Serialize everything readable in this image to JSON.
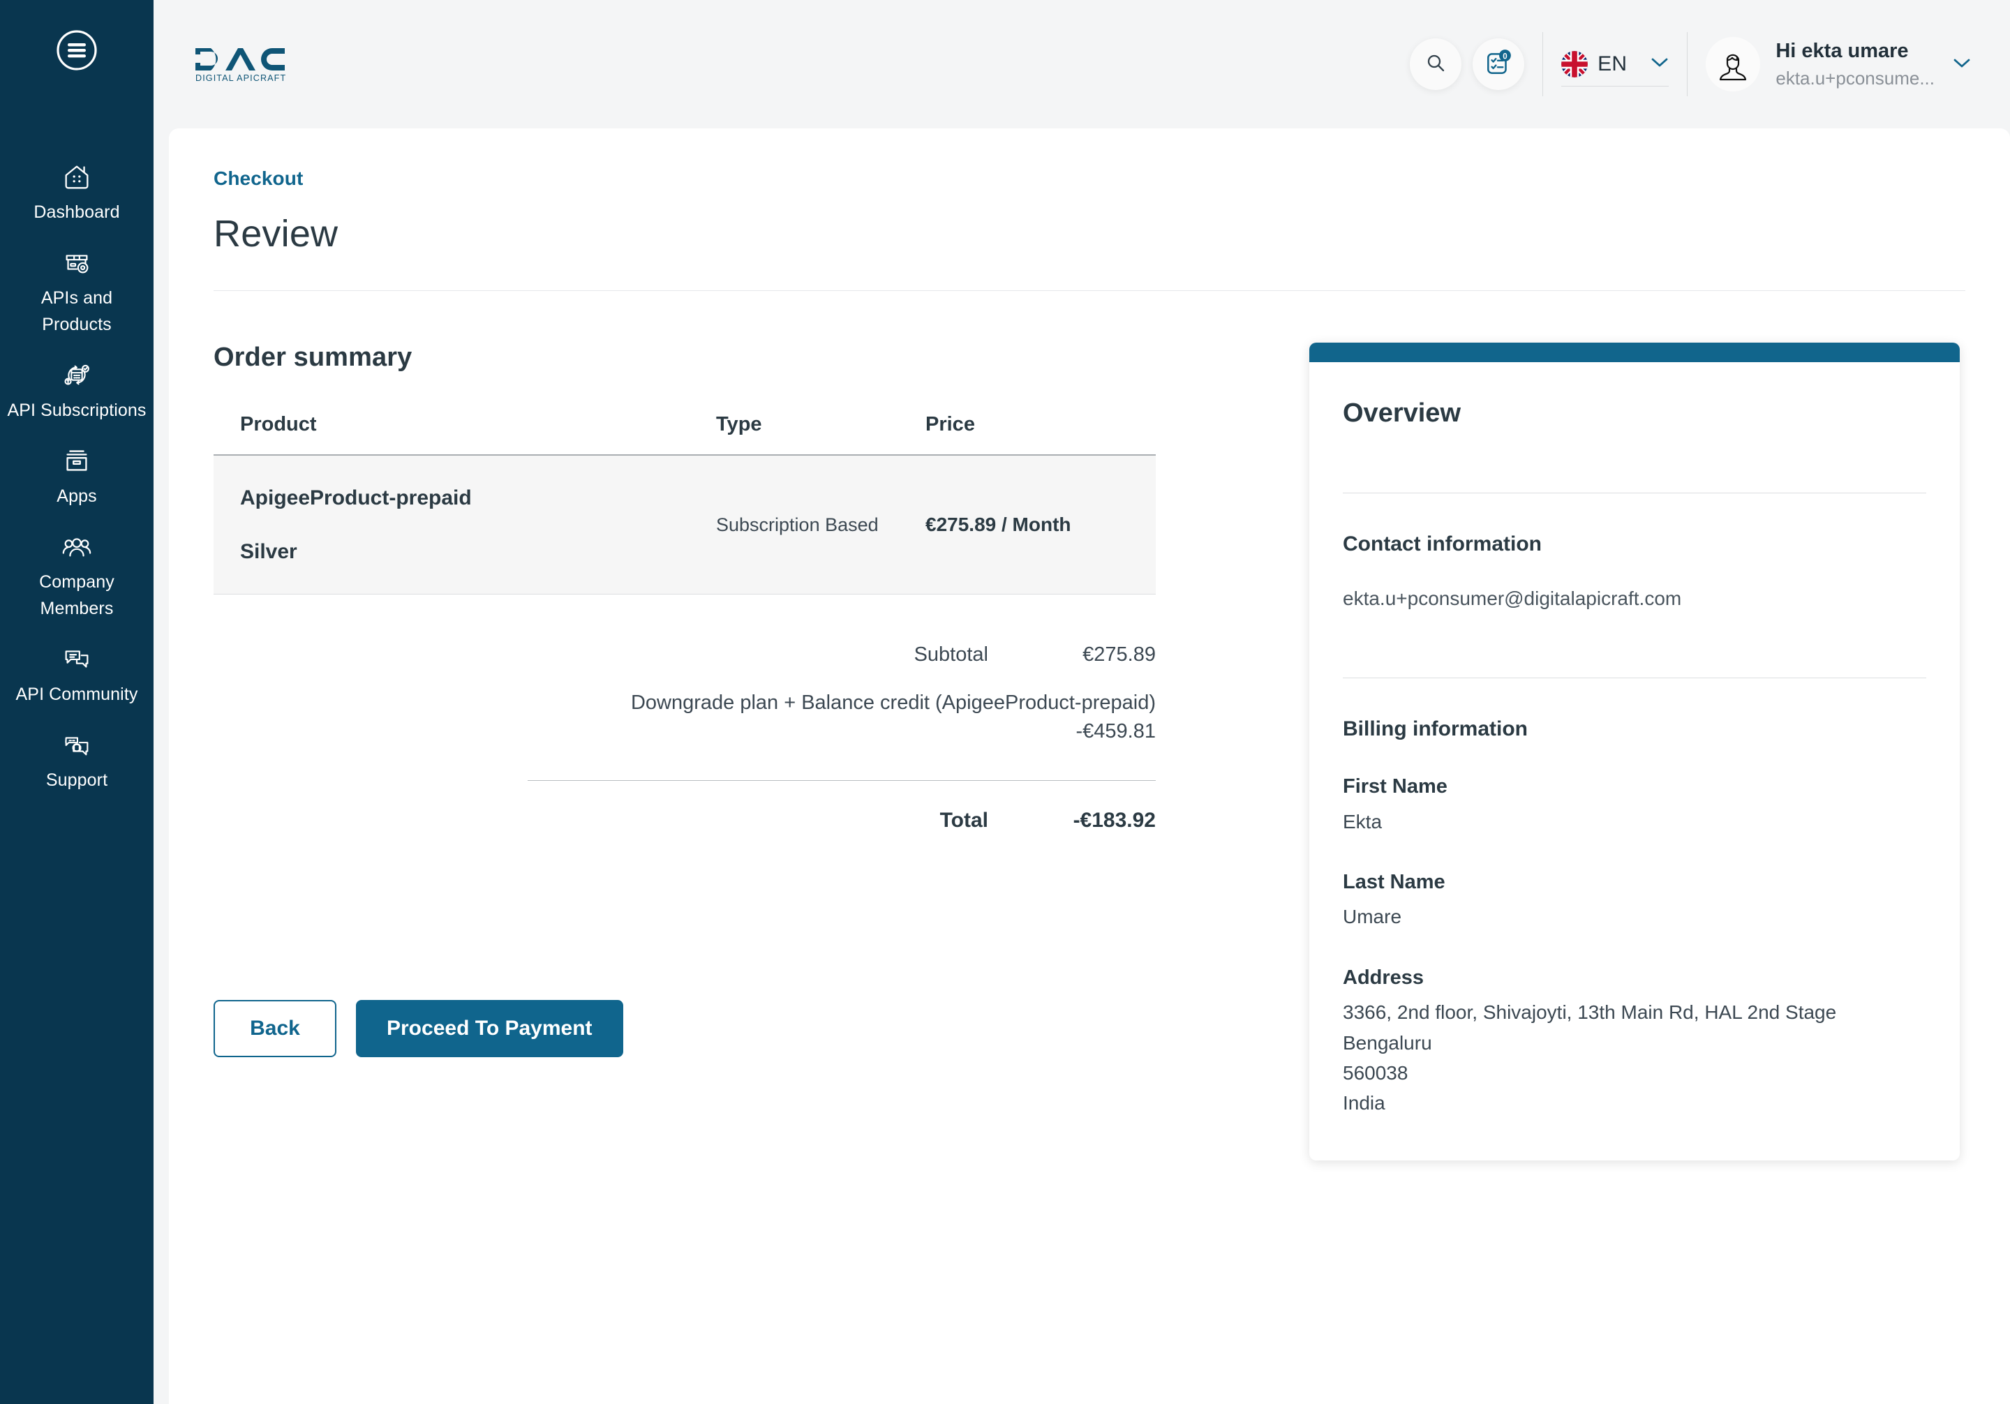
{
  "sidebar": {
    "menu_icon": "hamburger-menu-icon",
    "items": [
      {
        "label": "Dashboard",
        "icon": "dashboard-home-icon"
      },
      {
        "label": "APIs and Products",
        "icon": "api-products-box-gear-icon"
      },
      {
        "label": "API Subscriptions",
        "icon": "api-subscriptions-calendar-icon"
      },
      {
        "label": "Apps",
        "icon": "apps-archive-box-icon"
      },
      {
        "label": "Company Members",
        "icon": "company-members-people-icon"
      },
      {
        "label": "API Community",
        "icon": "api-community-chat-icon"
      },
      {
        "label": "Support",
        "icon": "support-headset-chat-icon"
      }
    ]
  },
  "topbar": {
    "logo_title": "DAC",
    "logo_subtitle": "DIGITAL APICRAFT",
    "search_icon": "search-icon",
    "tasks_icon": "checklist-icon",
    "tasks_badge": "0",
    "language_code": "EN",
    "language_flag": "uk-flag-icon",
    "user_greeting": "Hi ekta umare",
    "user_email": "ekta.u+pconsume...",
    "avatar_icon": "user-avatar-icon",
    "chevron_icon": "chevron-down-icon"
  },
  "page": {
    "breadcrumb": "Checkout",
    "title": "Review"
  },
  "order_summary": {
    "heading": "Order summary",
    "columns": [
      "Product",
      "Type",
      "Price"
    ],
    "rows": [
      {
        "product_name": "ApigeeProduct-prepaid",
        "product_tier": "Silver",
        "type": "Subscription Based",
        "price": "€275.89 / Month"
      }
    ],
    "totals": [
      {
        "label": "Subtotal",
        "value": "€275.89",
        "stacked": false
      },
      {
        "label": "Downgrade plan + Balance credit (ApigeeProduct-prepaid)",
        "value": "-€459.81",
        "stacked": true
      }
    ],
    "total_label": "Total",
    "total_value": "-€183.92"
  },
  "actions": {
    "back_label": "Back",
    "proceed_label": "Proceed To Payment"
  },
  "overview": {
    "title": "Overview",
    "contact_heading": "Contact information",
    "contact_email": "ekta.u+pconsumer@digitalapicraft.com",
    "billing_heading": "Billing information",
    "first_name_label": "First Name",
    "first_name_value": "Ekta",
    "last_name_label": "Last Name",
    "last_name_value": "Umare",
    "address_label": "Address",
    "address_lines": [
      "3366, 2nd floor, Shivajoyti, 13th Main Rd, HAL 2nd Stage",
      "Bengaluru",
      "560038",
      "India"
    ]
  },
  "colors": {
    "sidebar_bg": "#09364f",
    "accent": "#10658d",
    "page_bg": "#f4f5f6",
    "row_bg": "#f6f6f6",
    "text_dark": "#2b3a43"
  }
}
